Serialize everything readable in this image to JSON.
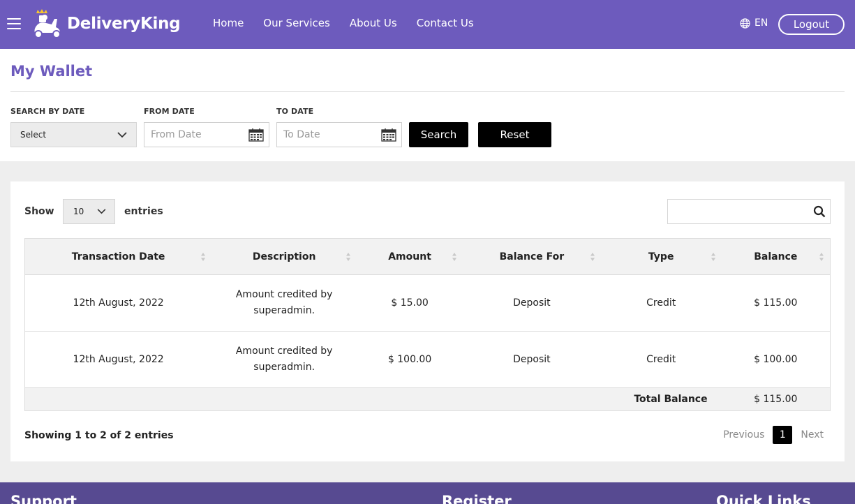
{
  "header": {
    "brand": "DeliveryKing",
    "nav": [
      "Home",
      "Our Services",
      "About Us",
      "Contact Us"
    ],
    "language": "EN",
    "logout_label": "Logout",
    "bg_color": "#6d5bbd"
  },
  "page": {
    "title": "My Wallet"
  },
  "filters": {
    "search_by_date_label": "SEARCH BY DATE",
    "search_by_date_value": "Select",
    "from_date_label": "FROM DATE",
    "from_date_placeholder": "From Date",
    "to_date_label": "TO DATE",
    "to_date_placeholder": "To Date",
    "search_button": "Search",
    "reset_button": "Reset"
  },
  "table_controls": {
    "show_label": "Show",
    "entries_value": "10",
    "entries_label": "entries"
  },
  "table": {
    "columns": [
      "Transaction Date",
      "Description",
      "Amount",
      "Balance For",
      "Type",
      "Balance"
    ],
    "rows": [
      {
        "date": "12th August, 2022",
        "description": "Amount credited by superadmin.",
        "amount": "$ 15.00",
        "balance_for": "Deposit",
        "type": "Credit",
        "balance": "$ 115.00"
      },
      {
        "date": "12th August, 2022",
        "description": "Amount credited by superadmin.",
        "amount": "$ 100.00",
        "balance_for": "Deposit",
        "type": "Credit",
        "balance": "$ 100.00"
      }
    ],
    "total_label": "Total Balance",
    "total_value": "$ 115.00"
  },
  "pagination": {
    "info": "Showing 1 to 2 of 2 entries",
    "previous": "Previous",
    "current": "1",
    "next": "Next"
  },
  "footer": {
    "headings": [
      "Support",
      "Register",
      "Quick Links"
    ]
  }
}
